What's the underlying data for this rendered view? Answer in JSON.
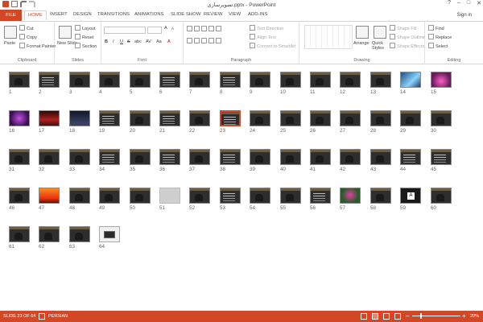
{
  "window": {
    "title": "تصویرسازی.pptx - PowerPoint",
    "controls": [
      "?",
      "–",
      "□",
      "✕"
    ]
  },
  "ribbon_tabs": [
    "FILE",
    "HOME",
    "INSERT",
    "DESIGN",
    "TRANSITIONS",
    "ANIMATIONS",
    "SLIDE SHOW",
    "REVIEW",
    "VIEW",
    "ADD-INS"
  ],
  "active_tab": "HOME",
  "sign_in": "Sign in",
  "groups": {
    "clipboard": {
      "label": "Clipboard",
      "paste": "Paste",
      "cut": "Cut",
      "copy": "Copy",
      "format_painter": "Format Painter"
    },
    "slides": {
      "label": "Slides",
      "new_slide": "New Slide",
      "layout": "Layout",
      "reset": "Reset",
      "section": "Section"
    },
    "font": {
      "label": "Font",
      "bold": "B",
      "italic": "I",
      "underline": "U",
      "strike": "S",
      "shadow": "abc",
      "spacing": "AV",
      "case": "Aa",
      "grow": "A",
      "shrink": "A"
    },
    "paragraph": {
      "label": "Paragraph",
      "text_direction": "Text Direction",
      "align_text": "Align Text",
      "convert_smartart": "Convert to SmartArt"
    },
    "drawing": {
      "label": "Drawing",
      "arrange": "Arrange",
      "quick_styles": "Quick Styles",
      "shape_fill": "Shape Fill",
      "shape_outline": "Shape Outline",
      "shape_effects": "Shape Effects"
    },
    "editing": {
      "label": "Editing",
      "find": "Find",
      "replace": "Replace",
      "select": "Select"
    }
  },
  "slides": [
    {
      "n": "1",
      "kind": "dark"
    },
    {
      "n": "2",
      "kind": "text"
    },
    {
      "n": "3",
      "kind": "dark"
    },
    {
      "n": "4",
      "kind": "dark"
    },
    {
      "n": "5",
      "kind": "dark"
    },
    {
      "n": "6",
      "kind": "text"
    },
    {
      "n": "7",
      "kind": "dark"
    },
    {
      "n": "8",
      "kind": "text"
    },
    {
      "n": "9",
      "kind": "dark"
    },
    {
      "n": "10",
      "kind": "dark"
    },
    {
      "n": "11",
      "kind": "dark"
    },
    {
      "n": "12",
      "kind": "dark"
    },
    {
      "n": "13",
      "kind": "dark"
    },
    {
      "n": "14",
      "kind": "blue"
    },
    {
      "n": "15",
      "kind": "pink"
    },
    {
      "n": "16",
      "kind": "purple"
    },
    {
      "n": "17",
      "kind": "red"
    },
    {
      "n": "18",
      "kind": "night"
    },
    {
      "n": "19",
      "kind": "text"
    },
    {
      "n": "20",
      "kind": "dark"
    },
    {
      "n": "21",
      "kind": "text"
    },
    {
      "n": "22",
      "kind": "dark"
    },
    {
      "n": "23",
      "kind": "text"
    },
    {
      "n": "24",
      "kind": "dark"
    },
    {
      "n": "25",
      "kind": "dark"
    },
    {
      "n": "26",
      "kind": "dark"
    },
    {
      "n": "27",
      "kind": "dark"
    },
    {
      "n": "28",
      "kind": "dark"
    },
    {
      "n": "29",
      "kind": "dark"
    },
    {
      "n": "30",
      "kind": "dark"
    },
    {
      "n": "31",
      "kind": "dark"
    },
    {
      "n": "32",
      "kind": "dark"
    },
    {
      "n": "33",
      "kind": "dark"
    },
    {
      "n": "34",
      "kind": "text"
    },
    {
      "n": "35",
      "kind": "dark"
    },
    {
      "n": "36",
      "kind": "text"
    },
    {
      "n": "37",
      "kind": "dark"
    },
    {
      "n": "38",
      "kind": "text"
    },
    {
      "n": "39",
      "kind": "dark"
    },
    {
      "n": "40",
      "kind": "dark"
    },
    {
      "n": "41",
      "kind": "dark"
    },
    {
      "n": "42",
      "kind": "dark"
    },
    {
      "n": "43",
      "kind": "dark"
    },
    {
      "n": "44",
      "kind": "text"
    },
    {
      "n": "45",
      "kind": "text"
    },
    {
      "n": "46",
      "kind": "dark"
    },
    {
      "n": "47",
      "kind": "sunset"
    },
    {
      "n": "48",
      "kind": "dark"
    },
    {
      "n": "49",
      "kind": "dark"
    },
    {
      "n": "50",
      "kind": "dark"
    },
    {
      "n": "51",
      "kind": "grey"
    },
    {
      "n": "52",
      "kind": "dark"
    },
    {
      "n": "53",
      "kind": "text"
    },
    {
      "n": "54",
      "kind": "dark"
    },
    {
      "n": "55",
      "kind": "dark"
    },
    {
      "n": "56",
      "kind": "text"
    },
    {
      "n": "57",
      "kind": "flower"
    },
    {
      "n": "58",
      "kind": "dark"
    },
    {
      "n": "59",
      "kind": "logo"
    },
    {
      "n": "60",
      "kind": "dark"
    },
    {
      "n": "61",
      "kind": "dark"
    },
    {
      "n": "62",
      "kind": "dark"
    },
    {
      "n": "63",
      "kind": "dark"
    },
    {
      "n": "64",
      "kind": "laptop"
    }
  ],
  "selected_slide": "23",
  "status": {
    "slide_info": "SLIDE 23 OF 64",
    "language": "PERSIAN",
    "zoom": "20%",
    "zoom_minus": "–",
    "zoom_plus": "+"
  },
  "colors": {
    "accent": "#d24726"
  }
}
